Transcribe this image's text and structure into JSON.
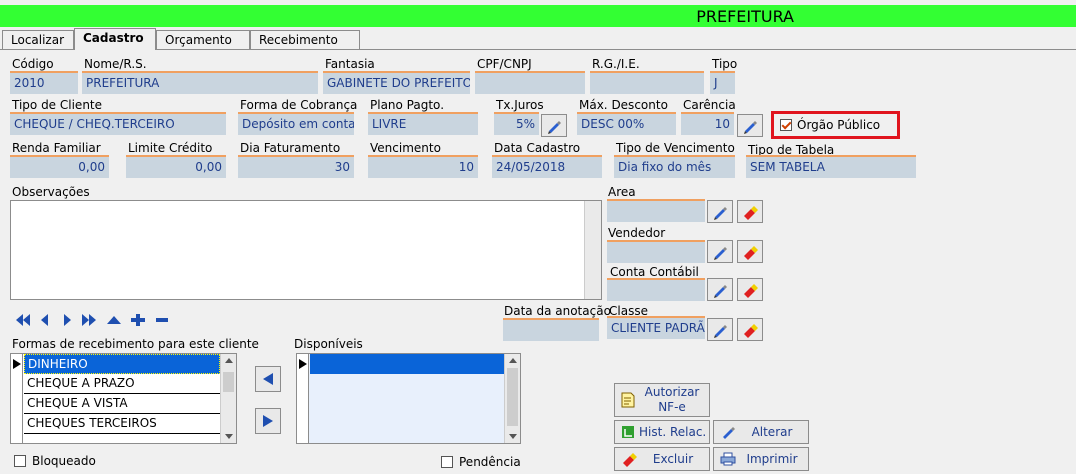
{
  "window": {
    "title": "PREFEITURA"
  },
  "tabs": [
    "Localizar",
    "Cadastro",
    "Orçamento",
    "Recebimento"
  ],
  "fields": {
    "codigo": {
      "label": "Código",
      "value": "2010"
    },
    "nome": {
      "label": "Nome/R.S.",
      "value": "PREFEITURA"
    },
    "fantasia": {
      "label": "Fantasia",
      "value": "GABINETE DO PREFEITO"
    },
    "cpf": {
      "label": "CPF/CNPJ",
      "value": ""
    },
    "rg": {
      "label": "R.G./I.E.",
      "value": ""
    },
    "tipo": {
      "label": "Tipo",
      "value": "J"
    },
    "tipo_cliente": {
      "label": "Tipo de Cliente",
      "value": "CHEQUE / CHEQ.TERCEIRO"
    },
    "forma_cobranca": {
      "label": "Forma de Cobrança",
      "value": "Depósito em conta"
    },
    "plano_pagto": {
      "label": "Plano Pagto.",
      "value": "LIVRE"
    },
    "tx_juros": {
      "label": "Tx.Juros",
      "value": "5%"
    },
    "max_desconto": {
      "label": "Máx. Desconto",
      "value": "DESC 00%"
    },
    "carencia": {
      "label": "Carência",
      "value": "10"
    },
    "orgao_publico": {
      "label": "Órgão Público",
      "checked": true
    },
    "renda_familiar": {
      "label": "Renda Familiar",
      "value": "0,00"
    },
    "limite_credito": {
      "label": "Limite Crédito",
      "value": "0,00"
    },
    "dia_faturamento": {
      "label": "Dia Faturamento",
      "value": "30"
    },
    "vencimento": {
      "label": "Vencimento",
      "value": "10"
    },
    "data_cadastro": {
      "label": "Data Cadastro",
      "value": "24/05/2018"
    },
    "tipo_vencimento": {
      "label": "Tipo de Vencimento",
      "value": "Dia fixo do mês"
    },
    "tipo_tabela": {
      "label": "Tipo de Tabela",
      "value": "SEM TABELA"
    },
    "observacoes": {
      "label": "Observações",
      "value": ""
    },
    "area": {
      "label": "Area",
      "value": ""
    },
    "vendedor": {
      "label": "Vendedor",
      "value": ""
    },
    "conta_contabil": {
      "label": "Conta Contábil",
      "value": ""
    },
    "classe": {
      "label": "Classe",
      "value": "CLIENTE PADRÃO"
    },
    "data_anotacao": {
      "label": "Data da anotação",
      "value": ""
    }
  },
  "formas": {
    "label": "Formas de recebimento para este cliente",
    "items": [
      "DINHEIRO",
      "CHEQUE A PRAZO",
      "CHEQUE A VISTA",
      "CHEQUES TERCEIROS"
    ]
  },
  "disponiveis": {
    "label": "Disponíveis",
    "items": [
      ""
    ]
  },
  "checks": {
    "bloqueado": "Bloqueado",
    "pendencia": "Pendência"
  },
  "buttons": {
    "autorizar": "Autorizar NF-e",
    "hist": "Hist. Relac.",
    "alterar": "Alterar",
    "excluir": "Excluir",
    "imprimir": "Imprimir"
  },
  "colors": {
    "title_bg": "#33ff33",
    "field_bg": "#c9d5df",
    "field_text": "#1f3d8c",
    "highlight": "#e0141e",
    "selection": "#0a64d8"
  }
}
